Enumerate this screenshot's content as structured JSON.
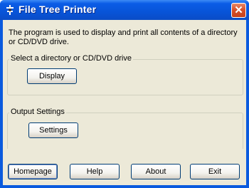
{
  "window": {
    "title": "File Tree Printer",
    "close_label": "✕"
  },
  "description": "The program is used to display and print all contents of a directory or CD/DVD drive.",
  "select_group": {
    "label": "Select a directory or CD/DVD drive",
    "display_button": "Display"
  },
  "output_group": {
    "label": "Output Settings",
    "settings_button": "Settings"
  },
  "footer": {
    "homepage_button": "Homepage",
    "help_button": "Help",
    "about_button": "About",
    "exit_button": "Exit"
  }
}
